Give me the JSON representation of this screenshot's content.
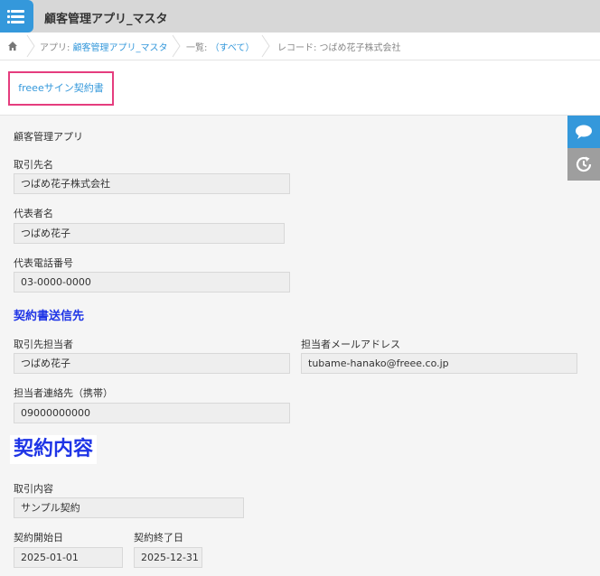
{
  "app": {
    "title": "顧客管理アプリ_マスタ"
  },
  "breadcrumb": {
    "app_prefix": "アプリ: ",
    "app_name": "顧客管理アプリ_マスタ",
    "list_prefix": "一覧: ",
    "list_name": "（すべて）",
    "record": "レコード: つばめ花子株式会社"
  },
  "actions": {
    "freee_button": "freeeサイン契約書"
  },
  "form": {
    "app_label": "顧客管理アプリ",
    "client_name": {
      "label": "取引先名",
      "value": "つばめ花子株式会社"
    },
    "representative": {
      "label": "代表者名",
      "value": "つばめ花子"
    },
    "rep_phone": {
      "label": "代表電話番号",
      "value": "03-0000-0000"
    },
    "section_send_to": "契約書送信先",
    "client_contact": {
      "label": "取引先担当者",
      "value": "つばめ花子"
    },
    "contact_email": {
      "label": "担当者メールアドレス",
      "value": "tubame-hanako@freee.co.jp"
    },
    "contact_mobile": {
      "label": "担当者連絡先（携帯）",
      "value": "09000000000"
    },
    "section_contract": "契約内容",
    "deal_content": {
      "label": "取引内容",
      "value": "サンプル契約"
    },
    "start_date": {
      "label": "契約開始日",
      "value": "2025-01-01"
    },
    "end_date": {
      "label": "契約終了日",
      "value": "2025-12-31"
    }
  },
  "colors": {
    "accent": "#3498db",
    "highlight_border": "#e53d7e",
    "section_heading": "#1e34e6"
  },
  "icons": [
    "app-list-icon",
    "home-icon",
    "comment-icon",
    "history-icon"
  ]
}
